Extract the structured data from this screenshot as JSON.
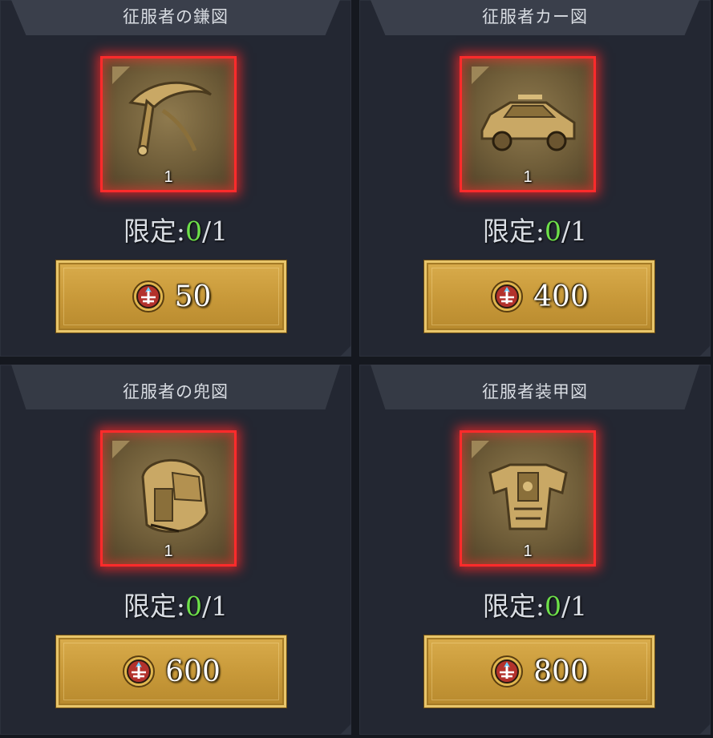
{
  "items": [
    {
      "title": "征服者の鎌図",
      "quantity": "1",
      "limit_label": "限定:",
      "limit_current": "0",
      "limit_total": "/1",
      "price": "50",
      "icon": "scythe-icon"
    },
    {
      "title": "征服者カー図",
      "quantity": "1",
      "limit_label": "限定:",
      "limit_current": "0",
      "limit_total": "/1",
      "price": "400",
      "icon": "car-icon"
    },
    {
      "title": "征服者の兜図",
      "quantity": "1",
      "limit_label": "限定:",
      "limit_current": "0",
      "limit_total": "/1",
      "price": "600",
      "icon": "helmet-icon"
    },
    {
      "title": "征服者装甲図",
      "quantity": "1",
      "limit_label": "限定:",
      "limit_current": "0",
      "limit_total": "/1",
      "price": "800",
      "icon": "armor-icon"
    }
  ],
  "currency_icon": "medal-coin-icon",
  "colors": {
    "frame_glow": "#ff2b2b",
    "limit_current": "#6ee04a",
    "button_gold": "#c99a3a",
    "panel_bg": "#232732"
  }
}
